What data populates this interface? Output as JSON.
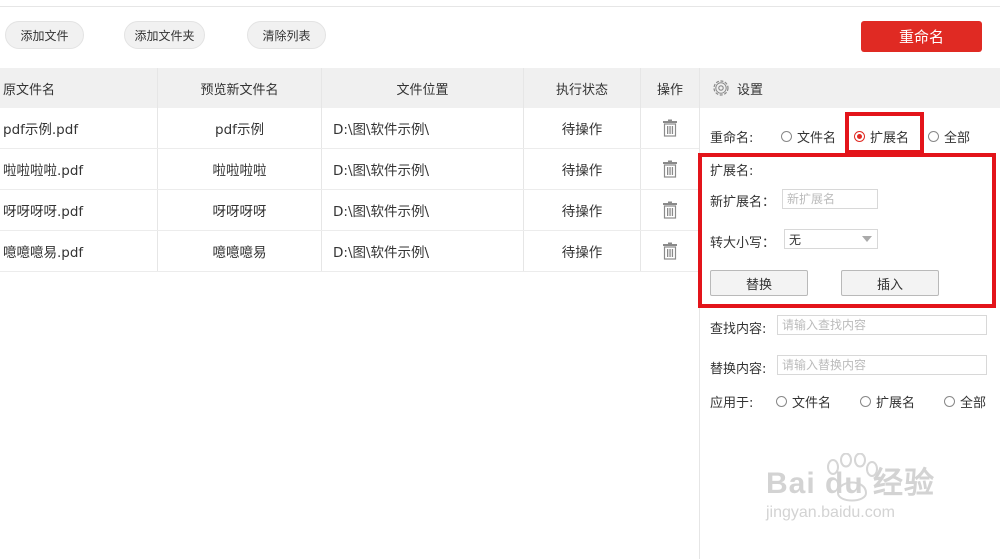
{
  "toolbar": {
    "add_file": "添加文件",
    "add_folder": "添加文件夹",
    "clear_list": "清除列表",
    "rename": "重命名"
  },
  "table": {
    "columns": [
      "原文件名",
      "预览新文件名",
      "文件位置",
      "执行状态",
      "操作"
    ],
    "rows": [
      {
        "original": "pdf示例.pdf",
        "preview": "pdf示例",
        "location": "D:\\图\\软件示例\\",
        "status": "待操作"
      },
      {
        "original": "啦啦啦啦.pdf",
        "preview": "啦啦啦啦",
        "location": "D:\\图\\软件示例\\",
        "status": "待操作"
      },
      {
        "original": "呀呀呀呀.pdf",
        "preview": "呀呀呀呀",
        "location": "D:\\图\\软件示例\\",
        "status": "待操作"
      },
      {
        "original": "噫噫噫易.pdf",
        "preview": "噫噫噫易",
        "location": "D:\\图\\软件示例\\",
        "status": "待操作"
      }
    ]
  },
  "settings": {
    "title": "设置",
    "rename_label": "重命名:",
    "rename_options": [
      "文件名",
      "扩展名",
      "全部"
    ],
    "rename_selected": "扩展名",
    "ext_section": "扩展名:",
    "new_ext_label": "新扩展名：",
    "new_ext_placeholder": "新扩展名",
    "case_label": "转大小写：",
    "case_value": "无",
    "replace_button": "替换",
    "insert_button": "插入",
    "find_label": "查找内容:",
    "find_placeholder": "请输入查找内容",
    "replace_label": "替换内容:",
    "replace_placeholder": "请输入替换内容",
    "apply_label": "应用于:",
    "apply_options": [
      "文件名",
      "扩展名",
      "全部"
    ]
  },
  "watermark": {
    "main": "Bai du 经验",
    "sub": "jingyan.baidu.com"
  },
  "colors": {
    "accent": "#e02a23",
    "highlight": "#e3141a",
    "header_bg": "#f0f0f0"
  }
}
